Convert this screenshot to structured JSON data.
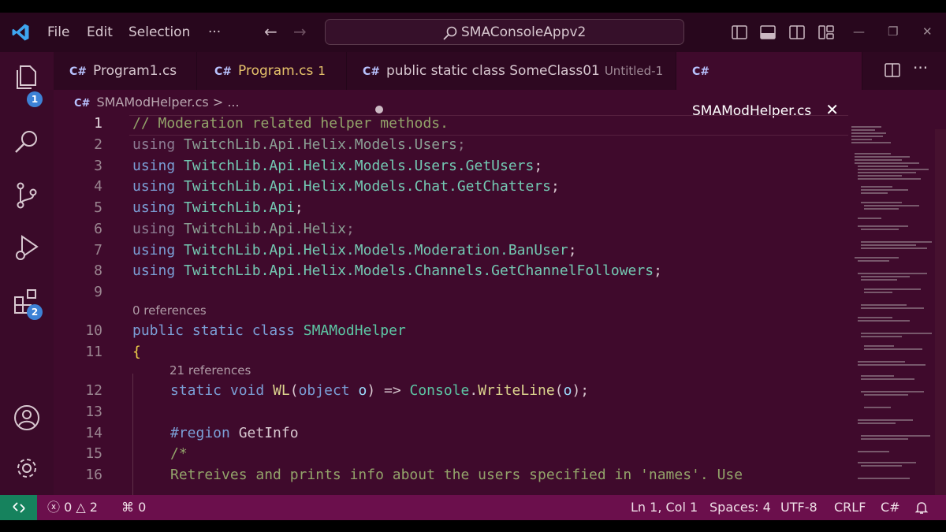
{
  "titlebar": {
    "menu": [
      "File",
      "Edit",
      "Selection",
      "···"
    ],
    "search_text": "SMAConsoleAppv2"
  },
  "activity": {
    "explorer_badge": "1",
    "extensions_badge": "2"
  },
  "tabs": [
    {
      "label": "Program1.cs",
      "icon": "C#"
    },
    {
      "label": "Program.cs",
      "badge": "1",
      "icon": "C#"
    },
    {
      "label": "public static class SomeClass01",
      "sub": "Untitled-1",
      "icon": "C#"
    },
    {
      "label": "SMAModHelper.cs",
      "icon": "C#"
    }
  ],
  "breadcrumb": {
    "file": "SMAModHelper.cs",
    "sep": ">",
    "more": "..."
  },
  "editor": {
    "line_numbers": [
      "1",
      "2",
      "3",
      "4",
      "5",
      "6",
      "7",
      "8",
      "9",
      "10",
      "11",
      "12",
      "13",
      "14",
      "15",
      "16"
    ],
    "lens_0": "0 references",
    "lens_21": "21 references",
    "code": {
      "l1": "// Moderation related helper methods.",
      "using": "using",
      "l2_ns": "TwitchLib.Api.Helix.Models.Users",
      "l3_ns": "TwitchLib.Api.Helix.Models.Users.GetUsers",
      "l4_ns": "TwitchLib.Api.Helix.Models.Chat.GetChatters",
      "l5_ns": "TwitchLib.Api",
      "l6_ns": "TwitchLib.Api.Helix",
      "l7_ns": "TwitchLib.Api.Helix.Models.Moderation.BanUser",
      "l8_ns": "TwitchLib.Api.Helix.Models.Channels.GetChannelFollowers",
      "semi": ";",
      "l10_mod": "public static class",
      "l10_cls": "SMAModHelper",
      "l11": "{",
      "l12_kw": "static void",
      "l12_fn": "WL",
      "l12_p1": "(",
      "l12_kw2": "object",
      "l12_pm": "o",
      "l12_p2": ") => ",
      "l12_cls": "Console",
      "l12_dot": ".",
      "l12_fn2": "WriteLine",
      "l12_p3": "(",
      "l12_pm2": "o",
      "l12_p4": ");",
      "l14_kw": "#region",
      "l14_name": "GetInfo",
      "l15": "/*",
      "l16": "Retreives and prints info about the users specified in 'names'. Use"
    }
  },
  "status": {
    "errors": "0",
    "warnings": "2",
    "ports": "0",
    "position": "Ln 1, Col 1",
    "spaces": "Spaces: 4",
    "encoding": "UTF-8",
    "eol": "CRLF",
    "language": "C#"
  },
  "colors": {
    "titlebar": "#28071d",
    "editor_bg": "#3f0a2c",
    "status_bg": "#6b0f4c",
    "remote_bg": "#16825d",
    "accent_badge": "#3d82d6"
  }
}
